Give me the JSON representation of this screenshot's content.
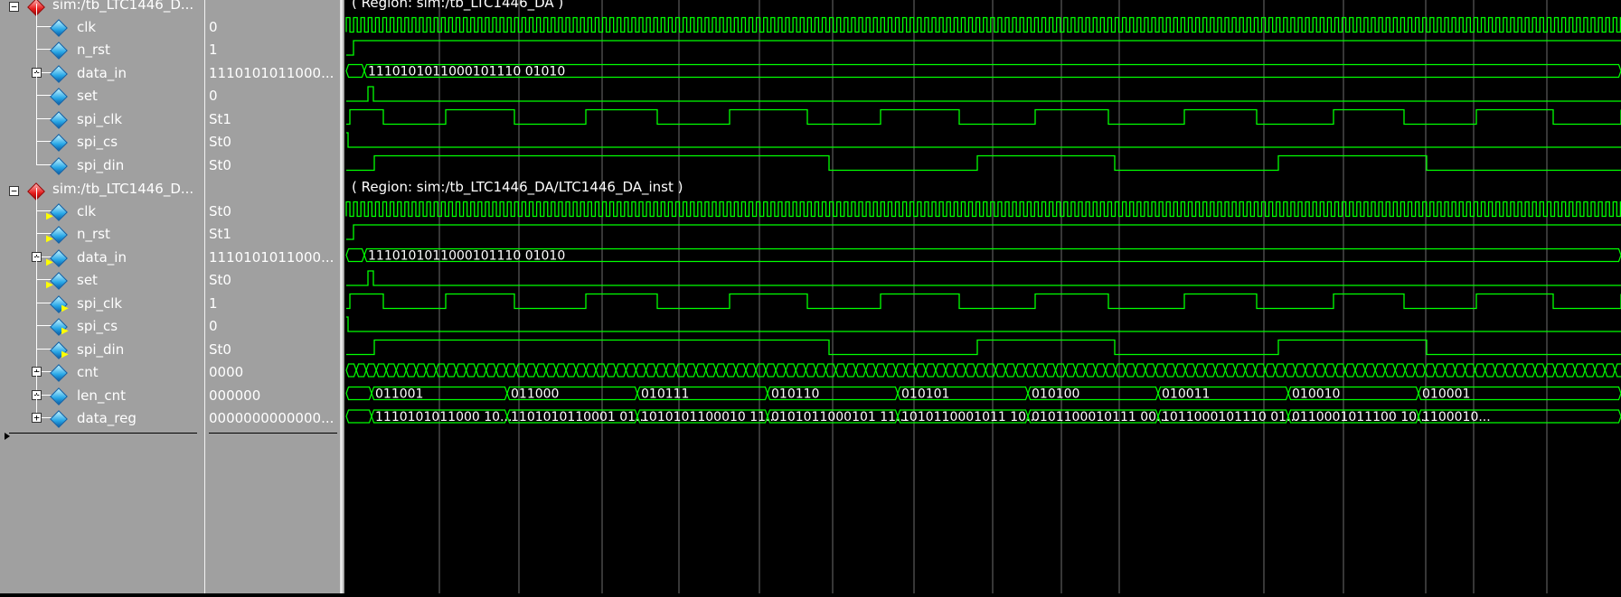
{
  "colors": {
    "wave": "#00ff00",
    "grid": "#6e6e6e",
    "panel": "#a0a0a0",
    "text": "#ffffff",
    "diamond_blue": "#27a6e6",
    "diamond_red": "#e61e1e"
  },
  "groups": [
    {
      "path": "sim:/tb_LTC1446_D...",
      "region_label": "( Region: sim:/tb_LTC1446_DA )",
      "signals": [
        {
          "name": "clk",
          "value": "0",
          "icon": "signal-diamond-icon"
        },
        {
          "name": "n_rst",
          "value": "1",
          "icon": "signal-diamond-icon"
        },
        {
          "name": "data_in",
          "value": "1110101011000...",
          "icon": "signal-diamond-icon",
          "expandable": true,
          "bus_value": "1110101011000101110 01010"
        },
        {
          "name": "set",
          "value": "0",
          "icon": "signal-diamond-icon"
        },
        {
          "name": "spi_clk",
          "value": "St1",
          "icon": "signal-diamond-icon"
        },
        {
          "name": "spi_cs",
          "value": "St0",
          "icon": "signal-diamond-icon"
        },
        {
          "name": "spi_din",
          "value": "St0",
          "icon": "signal-diamond-icon"
        }
      ]
    },
    {
      "path": "sim:/tb_LTC1446_D...",
      "region_label": "( Region: sim:/tb_LTC1446_DA/LTC1446_DA_inst )",
      "signals": [
        {
          "name": "clk",
          "value": "St0",
          "icon": "input-port-icon"
        },
        {
          "name": "n_rst",
          "value": "St1",
          "icon": "input-port-icon"
        },
        {
          "name": "data_in",
          "value": "1110101011000...",
          "icon": "input-port-icon",
          "expandable": true,
          "bus_value": "1110101011000101110 01010"
        },
        {
          "name": "set",
          "value": "St0",
          "icon": "input-port-icon"
        },
        {
          "name": "spi_clk",
          "value": "1",
          "icon": "output-port-icon"
        },
        {
          "name": "spi_cs",
          "value": "0",
          "icon": "output-port-icon"
        },
        {
          "name": "spi_din",
          "value": "St0",
          "icon": "output-port-icon"
        },
        {
          "name": "cnt",
          "value": "0000",
          "icon": "signal-diamond-icon",
          "expandable": true
        },
        {
          "name": "len_cnt",
          "value": "000000",
          "icon": "signal-diamond-icon",
          "expandable": true,
          "segments": [
            "011001",
            "011000",
            "010111",
            "010110",
            "010101",
            "010100",
            "010011",
            "010010",
            "010001"
          ]
        },
        {
          "name": "data_reg",
          "value": "0000000000000...",
          "icon": "signal-diamond-icon",
          "expandable": true,
          "segments": [
            "1110101011000 10...",
            "1101010110001 01...",
            "1010101100010 11...",
            "0101011000101 11...",
            "1010110001011 10...",
            "0101100010111 00...",
            "1011000101110 01...",
            "0110001011100 10...",
            "1100010..."
          ]
        }
      ]
    }
  ]
}
